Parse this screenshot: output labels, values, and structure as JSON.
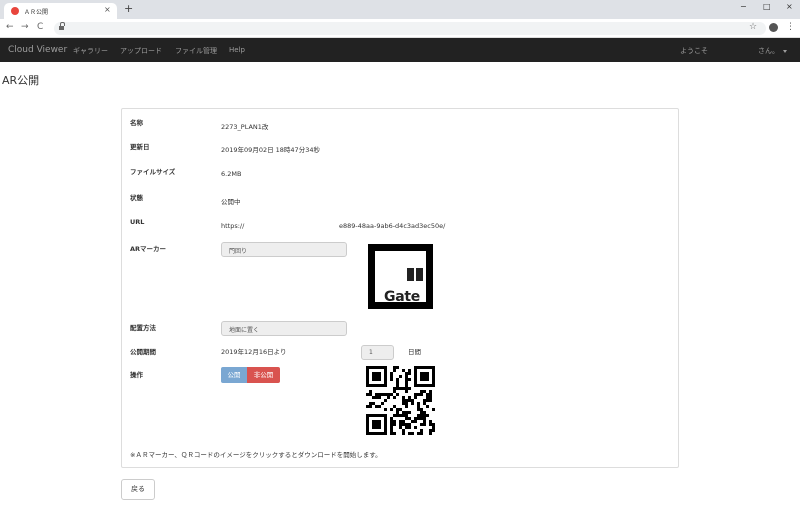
{
  "browser": {
    "tab_title": "ＡＲ公開",
    "close_glyph": "×",
    "new_tab_glyph": "+",
    "back_glyph": "←",
    "forward_glyph": "→",
    "reload_glyph": "C",
    "star_glyph": "☆",
    "menu_glyph": "⋮",
    "minimize_glyph": "−",
    "maximize_glyph": "□",
    "window_close_glyph": "×"
  },
  "navbar": {
    "brand": "Cloud Viewer",
    "links": [
      "ギャラリー",
      "アップロード",
      "ファイル管理",
      "Help"
    ],
    "welcome": "ようこそ",
    "user": "さん。"
  },
  "page": {
    "title": "AR公開"
  },
  "detail": {
    "name_label": "名称",
    "name_value": "2273_PLAN1改",
    "updated_label": "更新日",
    "updated_value": "2019年09月02日 18時47分34秒",
    "size_label": "ファイルサイズ",
    "size_value": "6.2MB",
    "status_label": "状態",
    "status_value": "公開中",
    "url_label": "URL",
    "url_prefix": "https://",
    "url_suffix": "e889-48aa-9ab6-d4c3ad3ec50e/",
    "marker_label": "ARマーカー",
    "marker_value": "門回り",
    "marker_image_text": "Gate",
    "placement_label": "配置方法",
    "placement_value": "地面に置く",
    "period_label": "公開期間",
    "period_value": "2019年12月16日より",
    "period_days": "1",
    "period_unit": "日間",
    "ops_label": "操作",
    "publish_button": "公開",
    "unpublish_button": "非公開",
    "note": "※ＡＲマーカー、ＱＲコードのイメージをクリックするとダウンロードを開始します。"
  },
  "back_button": "戻る"
}
